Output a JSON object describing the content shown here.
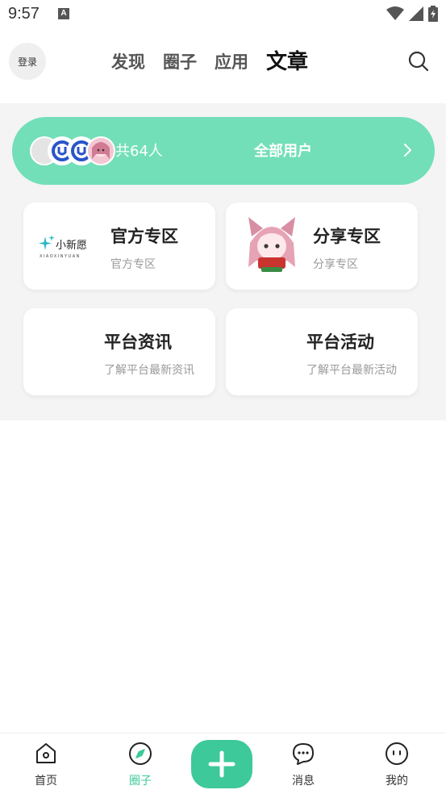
{
  "status_bar": {
    "time": "9:57",
    "notif_letter": "A"
  },
  "header": {
    "login_label": "登录",
    "tabs": [
      {
        "label": "发现"
      },
      {
        "label": "圈子"
      },
      {
        "label": "应用"
      },
      {
        "label": "文章"
      }
    ],
    "active_tab": "文章"
  },
  "users_bar": {
    "count_text": "共64人",
    "all_users_label": "全部用户"
  },
  "cards": [
    {
      "title": "官方专区",
      "subtitle": "官方专区",
      "logo_text": "小新愿",
      "logo_subtext": "XIAOXINYUAN"
    },
    {
      "title": "分享专区",
      "subtitle": "分享专区"
    },
    {
      "title": "平台资讯",
      "subtitle": "了解平台最新资讯"
    },
    {
      "title": "平台活动",
      "subtitle": "了解平台最新活动"
    }
  ],
  "bottom_nav": {
    "items": [
      {
        "label": "首页",
        "icon": "home-icon"
      },
      {
        "label": "圈子",
        "icon": "compass-icon"
      },
      {
        "label": "消息",
        "icon": "chat-icon"
      },
      {
        "label": "我的",
        "icon": "profile-icon"
      }
    ],
    "active_index": 1
  },
  "colors": {
    "accent": "#3ec99a",
    "users_bar": "#72dfb8",
    "content_bg": "#f4f4f4"
  }
}
